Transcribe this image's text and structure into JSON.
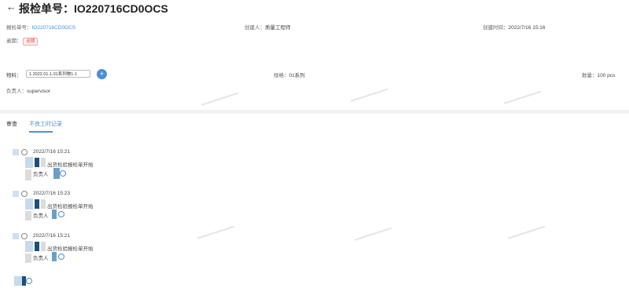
{
  "header": {
    "title": "报检单号：IO220716CD0OCS"
  },
  "info": {
    "order_no_label": "报检单号：",
    "order_no_value": "IO220716CD0OCS",
    "creator_label": "创建人：",
    "creator_value": "质量工程师",
    "created_time_label": "创建时间：",
    "created_time_value": "2022/7/16 15:16",
    "overdue_label": "逾期：",
    "overdue_badge": "逾期",
    "material_label": "物料：",
    "material_value": "1.2022.01.1.01系列物1-1",
    "spec_label": "规格：",
    "spec_value": "01系列",
    "quantity_label": "数量：",
    "quantity_value": "100 pcs",
    "owner_label": "负责人：",
    "owner_value": "supervisor"
  },
  "tabs": [
    {
      "label": "审查"
    },
    {
      "label": "不良工时记录"
    }
  ],
  "timeline": [
    {
      "time": "2022/7/16 15:21",
      "desc": "出货检验报检单开始",
      "owner": "负责人"
    },
    {
      "time": "2022/7/16 15:23",
      "desc": "出货检验报检单开始",
      "owner": "负责人"
    },
    {
      "time": "2022/7/16 15:21",
      "desc": "出货检验报检单开始",
      "owner": "负责人"
    }
  ],
  "icons": {
    "back": "arrow-left-icon",
    "plus": "plus-icon",
    "clock": "clock-icon"
  },
  "colors": {
    "accent": "#4a90d9",
    "danger": "#e05050",
    "divider": "#f1f2f4"
  }
}
